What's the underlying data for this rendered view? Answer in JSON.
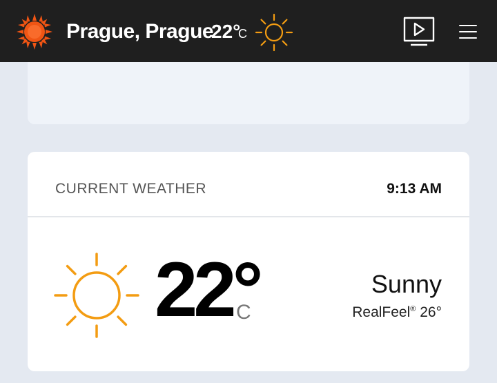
{
  "header": {
    "location": "Prague, Prague",
    "temperature": "22°",
    "unit": "C",
    "logo_icon": "sun-logo-icon",
    "weather_icon": "sun-icon",
    "video_icon": "video-play-icon",
    "menu_icon": "hamburger-menu-icon"
  },
  "current_weather": {
    "title": "CURRENT WEATHER",
    "time": "9:13 AM",
    "temperature": "22°",
    "unit": "C",
    "condition": "Sunny",
    "realfeel_label": "RealFeel",
    "realfeel_mark": "®",
    "realfeel_value": "26°"
  },
  "colors": {
    "header_bg": "#1f1f1f",
    "accent_orange": "#f05514",
    "sun_orange": "#f39c12",
    "page_bg": "#e4e9f1"
  }
}
